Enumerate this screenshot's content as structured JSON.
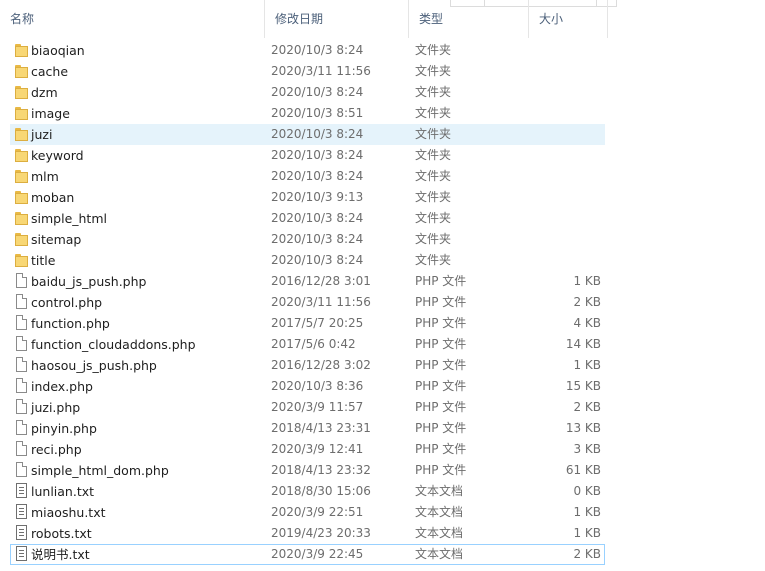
{
  "columns": {
    "name": "名称",
    "date": "修改日期",
    "type": "类型",
    "size": "大小"
  },
  "files": [
    {
      "name": "biaoqian",
      "date": "2020/10/3 8:24",
      "type": "文件夹",
      "size": "",
      "icon": "folder-icon"
    },
    {
      "name": "cache",
      "date": "2020/3/11 11:56",
      "type": "文件夹",
      "size": "",
      "icon": "folder-icon"
    },
    {
      "name": "dzm",
      "date": "2020/10/3 8:24",
      "type": "文件夹",
      "size": "",
      "icon": "folder-icon"
    },
    {
      "name": "image",
      "date": "2020/10/3 8:51",
      "type": "文件夹",
      "size": "",
      "icon": "folder-icon"
    },
    {
      "name": "juzi",
      "date": "2020/10/3 8:24",
      "type": "文件夹",
      "size": "",
      "icon": "folder-icon",
      "state": "hover"
    },
    {
      "name": "keyword",
      "date": "2020/10/3 8:24",
      "type": "文件夹",
      "size": "",
      "icon": "folder-icon"
    },
    {
      "name": "mlm",
      "date": "2020/10/3 8:24",
      "type": "文件夹",
      "size": "",
      "icon": "folder-icon"
    },
    {
      "name": "moban",
      "date": "2020/10/3 9:13",
      "type": "文件夹",
      "size": "",
      "icon": "folder-icon"
    },
    {
      "name": "simple_html",
      "date": "2020/10/3 8:24",
      "type": "文件夹",
      "size": "",
      "icon": "folder-icon"
    },
    {
      "name": "sitemap",
      "date": "2020/10/3 8:24",
      "type": "文件夹",
      "size": "",
      "icon": "folder-icon"
    },
    {
      "name": "title",
      "date": "2020/10/3 8:24",
      "type": "文件夹",
      "size": "",
      "icon": "folder-icon"
    },
    {
      "name": "baidu_js_push.php",
      "date": "2016/12/28 3:01",
      "type": "PHP 文件",
      "size": "1 KB",
      "icon": "php-file-icon"
    },
    {
      "name": "control.php",
      "date": "2020/3/11 11:56",
      "type": "PHP 文件",
      "size": "2 KB",
      "icon": "php-file-icon"
    },
    {
      "name": "function.php",
      "date": "2017/5/7 20:25",
      "type": "PHP 文件",
      "size": "4 KB",
      "icon": "php-file-icon"
    },
    {
      "name": "function_cloudaddons.php",
      "date": "2017/5/6 0:42",
      "type": "PHP 文件",
      "size": "14 KB",
      "icon": "php-file-icon"
    },
    {
      "name": "haosou_js_push.php",
      "date": "2016/12/28 3:02",
      "type": "PHP 文件",
      "size": "1 KB",
      "icon": "php-file-icon"
    },
    {
      "name": "index.php",
      "date": "2020/10/3 8:36",
      "type": "PHP 文件",
      "size": "15 KB",
      "icon": "php-file-icon"
    },
    {
      "name": "juzi.php",
      "date": "2020/3/9 11:57",
      "type": "PHP 文件",
      "size": "2 KB",
      "icon": "php-file-icon"
    },
    {
      "name": "pinyin.php",
      "date": "2018/4/13 23:31",
      "type": "PHP 文件",
      "size": "13 KB",
      "icon": "php-file-icon"
    },
    {
      "name": "reci.php",
      "date": "2020/3/9 12:41",
      "type": "PHP 文件",
      "size": "3 KB",
      "icon": "php-file-icon"
    },
    {
      "name": "simple_html_dom.php",
      "date": "2018/4/13 23:32",
      "type": "PHP 文件",
      "size": "61 KB",
      "icon": "php-file-icon"
    },
    {
      "name": "lunlian.txt",
      "date": "2018/8/30 15:06",
      "type": "文本文档",
      "size": "0 KB",
      "icon": "text-file-icon"
    },
    {
      "name": "miaoshu.txt",
      "date": "2020/3/9 22:51",
      "type": "文本文档",
      "size": "1 KB",
      "icon": "text-file-icon"
    },
    {
      "name": "robots.txt",
      "date": "2019/4/23 20:33",
      "type": "文本文档",
      "size": "1 KB",
      "icon": "text-file-icon"
    },
    {
      "name": "说明书.txt",
      "date": "2020/3/9 22:45",
      "type": "文本文档",
      "size": "2 KB",
      "icon": "text-file-icon",
      "state": "focus"
    }
  ]
}
